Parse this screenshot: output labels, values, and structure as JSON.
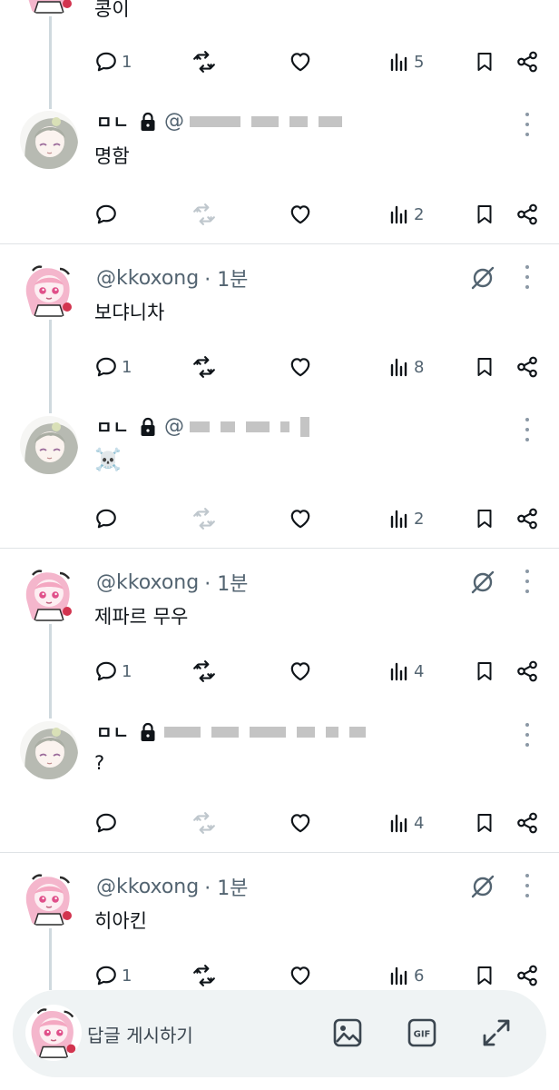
{
  "topText": "콩이",
  "threads": [
    {
      "main": null,
      "reply": {
        "name": "ㅁㄴ",
        "text": "명함",
        "stats": {
          "replies": "",
          "views": "2"
        }
      },
      "topStats": {
        "replies": "1",
        "views": "5"
      }
    },
    {
      "main": {
        "handle": "@kkoxong",
        "time": "· 1분",
        "text": "보댜니차",
        "stats": {
          "replies": "1",
          "views": "8"
        }
      },
      "reply": {
        "name": "ㅁㄴ",
        "text": "☠️",
        "stats": {
          "replies": "",
          "views": "2"
        }
      }
    },
    {
      "main": {
        "handle": "@kkoxong",
        "time": "· 1분",
        "text": "제파르 무우",
        "stats": {
          "replies": "1",
          "views": "4"
        }
      },
      "reply": {
        "name": "ㅁㄴ",
        "text": "?",
        "stats": {
          "replies": "",
          "views": "4"
        }
      }
    },
    {
      "main": {
        "handle": "@kkoxong",
        "time": "· 1분",
        "text": "히아킨",
        "stats": {
          "replies": "1",
          "views": "6"
        }
      },
      "reply": null
    }
  ],
  "composer": {
    "placeholder": "답글 게시하기"
  },
  "colors": {
    "text": "#0f1419",
    "muted": "#536471",
    "line": "#cfd9de",
    "retweetFaded": "#bfc7cd"
  }
}
